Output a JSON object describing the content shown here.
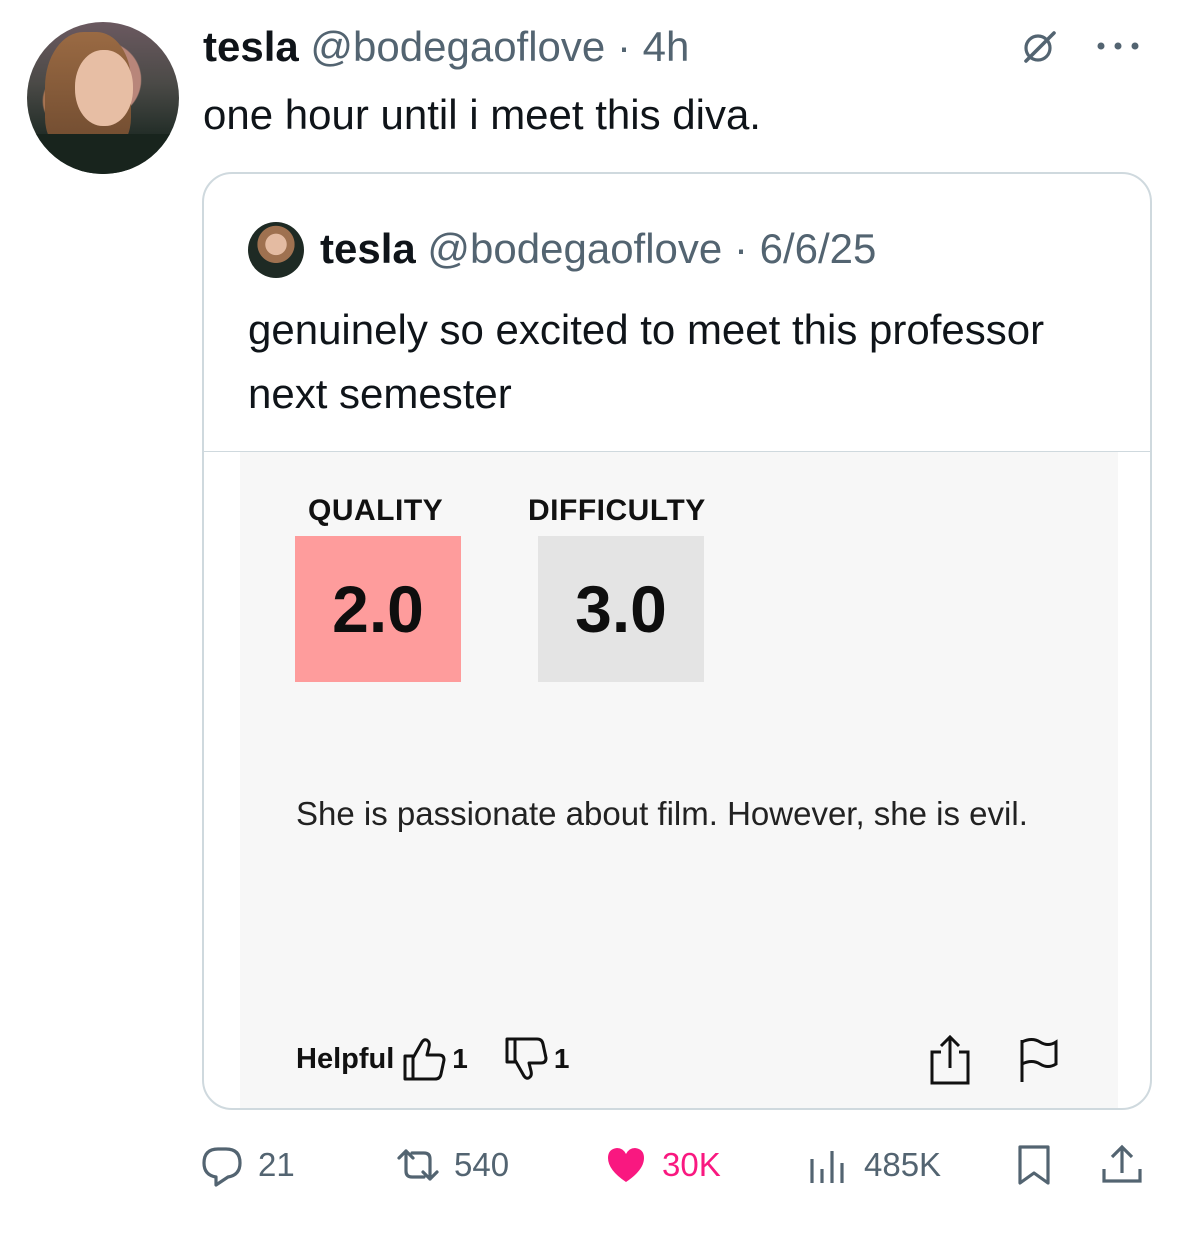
{
  "tweet": {
    "author_name": "tesla",
    "author_handle": "@bodegaoflove",
    "separator": "·",
    "time": "4h",
    "text": "one hour until i meet this diva."
  },
  "quoted_tweet": {
    "author_name": "tesla",
    "author_handle": "@bodegaoflove",
    "separator": "·",
    "date": "6/6/25",
    "text": "genuinely so excited to meet this professor next semester",
    "rating_card": {
      "quality_label": "QUALITY",
      "quality_value": "2.0",
      "difficulty_label": "DIFFICULTY",
      "difficulty_value": "3.0",
      "comment": "She is passionate about film. However, she is evil.",
      "helpful_label": "Helpful",
      "thumbs_up_count": "1",
      "thumbs_down_count": "1",
      "quality_color": "#fe9c9c",
      "difficulty_color": "#e4e4e4"
    }
  },
  "actions": {
    "replies": "21",
    "reposts": "540",
    "likes": "30K",
    "views": "485K",
    "like_color": "#f91880"
  },
  "icons": [
    "grok-icon",
    "more-icon",
    "thumbs-up-icon",
    "thumbs-down-icon",
    "share-icon",
    "flag-icon",
    "reply-icon",
    "repost-icon",
    "heart-icon",
    "views-icon",
    "bookmark-icon",
    "share-icon"
  ]
}
